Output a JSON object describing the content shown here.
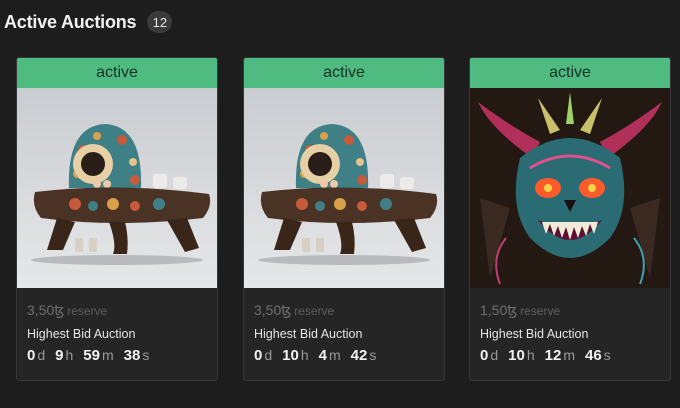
{
  "header": {
    "title": "Active Auctions",
    "count": "12"
  },
  "cards": [
    {
      "status": "active",
      "artwork": "monster-at-table",
      "price": "3,50ꜩ",
      "reserve_label": "reserve",
      "auction_type": "Highest Bid Auction",
      "countdown": {
        "d": "0",
        "d_unit": "d",
        "h": "9",
        "h_unit": "h",
        "m": "59",
        "m_unit": "m",
        "s": "38",
        "s_unit": "s"
      }
    },
    {
      "status": "active",
      "artwork": "monster-at-table",
      "price": "3,50ꜩ",
      "reserve_label": "reserve",
      "auction_type": "Highest Bid Auction",
      "countdown": {
        "d": "0",
        "d_unit": "d",
        "h": "10",
        "h_unit": "h",
        "m": "4",
        "m_unit": "m",
        "s": "42",
        "s_unit": "s"
      }
    },
    {
      "status": "active",
      "artwork": "horned-demon-skull",
      "price": "1,50ꜩ",
      "reserve_label": "reserve",
      "auction_type": "Highest Bid Auction",
      "countdown": {
        "d": "0",
        "d_unit": "d",
        "h": "10",
        "h_unit": "h",
        "m": "12",
        "m_unit": "m",
        "s": "46",
        "s_unit": "s"
      }
    }
  ],
  "colors": {
    "status_green": "#4fbb80",
    "background": "#1d1d1d",
    "card": "#252525"
  }
}
